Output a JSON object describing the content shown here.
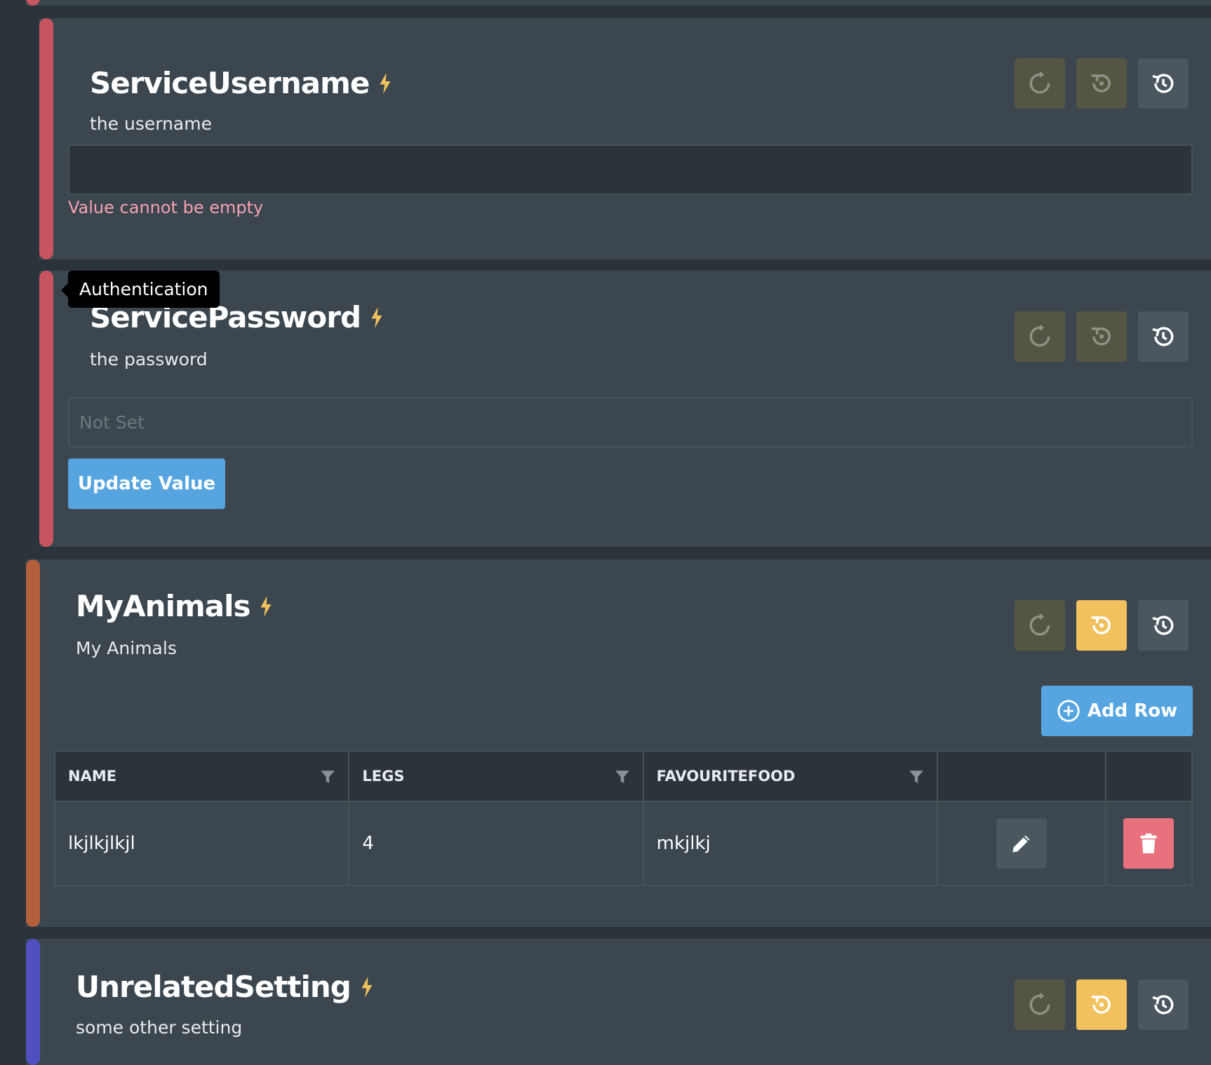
{
  "colors": {
    "accent_red": "#c65560",
    "accent_orange": "#b35f3c",
    "accent_indigo": "#5050c0",
    "card_bg": "#3b464e",
    "page_bg": "#2b343b",
    "primary_blue": "#56a5e0",
    "warning_yellow": "#f0c15c",
    "danger_pink": "#e9707d",
    "error_text": "#f4a3b0"
  },
  "icons": {
    "reset": "reset-icon",
    "revert": "revert-icon",
    "history": "history-icon",
    "lightning": "lightning-icon",
    "filter": "filter-icon",
    "add": "plus-circle-icon",
    "edit": "pencil-icon",
    "delete": "trash-icon"
  },
  "settings": [
    {
      "name": "ServiceUsername",
      "description": "the username",
      "value": "",
      "error": "Value cannot be empty"
    },
    {
      "name": "ServicePassword",
      "description": "the password",
      "placeholder": "Not Set",
      "update_label": "Update Value",
      "tooltip": "Authentication"
    },
    {
      "name": "MyAnimals",
      "description": "My Animals",
      "add_row_label": "Add Row",
      "columns": [
        "NAME",
        "LEGS",
        "FAVOURITEFOOD"
      ],
      "rows": [
        {
          "name": "lkjlkjlkjl",
          "legs": "4",
          "favouritefood": "mkjlkj"
        }
      ]
    },
    {
      "name": "UnrelatedSetting",
      "description": "some other setting"
    }
  ]
}
